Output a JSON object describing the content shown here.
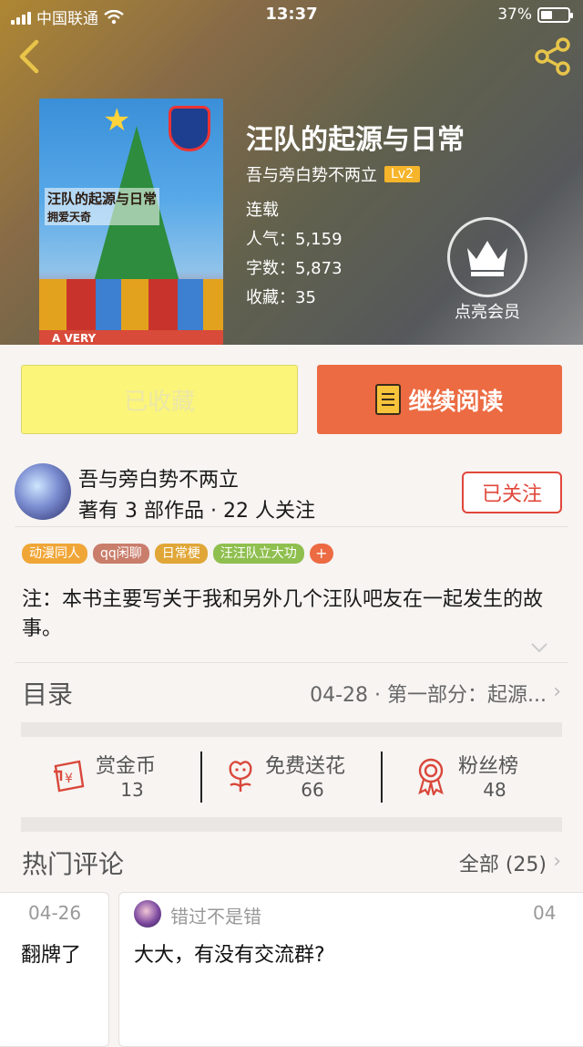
{
  "status_bar": {
    "carrier": "中国联通",
    "time": "13:37",
    "battery": "37%"
  },
  "book": {
    "title": "汪队的起源与日常",
    "author": "吾与旁白势不两立",
    "level": "Lv2",
    "status": "连载",
    "popularity_label": "人气：",
    "popularity": "5,159",
    "words_label": "字数：",
    "words": "5,873",
    "favorites_label": "收藏：",
    "favorites": "35",
    "cover_art_title": "汪队的起源与日常",
    "cover_art_subtitle": "拥爱天奇",
    "cover_footer_text": "A VERY"
  },
  "vip": {
    "label": "点亮会员"
  },
  "actions": {
    "collected_label": "已收藏",
    "read_label": "继续阅读"
  },
  "author_info": {
    "name": "吾与旁白势不两立",
    "stats": "著有 3 部作品 · 22 人关注",
    "follow_label": "已关注"
  },
  "tags": [
    {
      "label": "动漫同人",
      "color": "#f0a637"
    },
    {
      "label": "qq闲聊",
      "color": "#c97d6b"
    },
    {
      "label": "日常梗",
      "color": "#e0a637"
    },
    {
      "label": "汪汪队立大功",
      "color": "#8fbf4f"
    }
  ],
  "tag_add": "+",
  "intro": "注：本书主要写关于我和另外几个汪队吧友在一起发生的故事。",
  "catalog": {
    "title": "目录",
    "latest": "04-28 · 第一部分：起源..."
  },
  "stats": [
    {
      "label": "赏金币",
      "value": "13",
      "icon": "reward-coin-icon"
    },
    {
      "label": "免费送花",
      "value": "66",
      "icon": "flower-icon"
    },
    {
      "label": "粉丝榜",
      "value": "48",
      "icon": "medal-icon"
    }
  ],
  "comments": {
    "title": "热门评论",
    "all_label": "全部 (25)",
    "items": [
      {
        "date": "04-26",
        "text": "翻牌了"
      },
      {
        "user": "错过不是错",
        "date": "04",
        "text": "大大，有没有交流群?"
      }
    ]
  },
  "colors": {
    "accent": "#ec6b42",
    "follow": "#e0473a",
    "collected_bg": "#fbf57a",
    "level_badge": "#f5b42a"
  }
}
